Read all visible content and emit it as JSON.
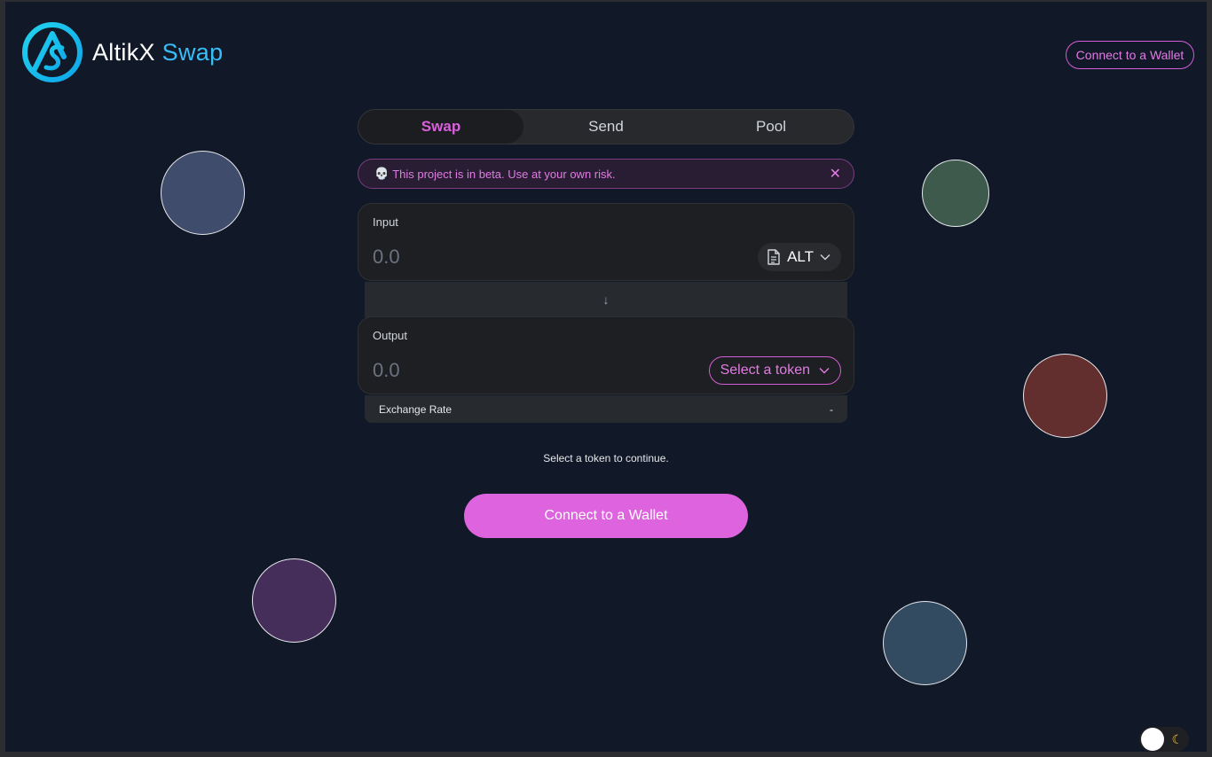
{
  "header": {
    "logo_text_main": "AltikX",
    "logo_text_accent": "Swap",
    "connect_label": "Connect to a Wallet"
  },
  "tabs": [
    {
      "label": "Swap",
      "active": true
    },
    {
      "label": "Send",
      "active": false
    },
    {
      "label": "Pool",
      "active": false
    }
  ],
  "beta_notice": {
    "icon": "skull-icon",
    "text": "This project is in beta. Use at your own risk.",
    "close_glyph": "✕"
  },
  "input": {
    "label": "Input",
    "placeholder": "0.0",
    "token": "ALT"
  },
  "output": {
    "label": "Output",
    "placeholder": "0.0",
    "token_button": "Select a token"
  },
  "exchange_rate": {
    "label": "Exchange Rate",
    "value": "-"
  },
  "hint": "Select a token to continue.",
  "main_button": "Connect to a Wallet",
  "colors": {
    "background": "#111827",
    "accent": "#dd63df",
    "logo_accent": "#38bdf8",
    "bubble_1": "#3f4c6b",
    "bubble_2": "#3e5a4c",
    "bubble_3": "#622f2e",
    "bubble_4": "#452f5a",
    "bubble_5": "#334b60"
  }
}
